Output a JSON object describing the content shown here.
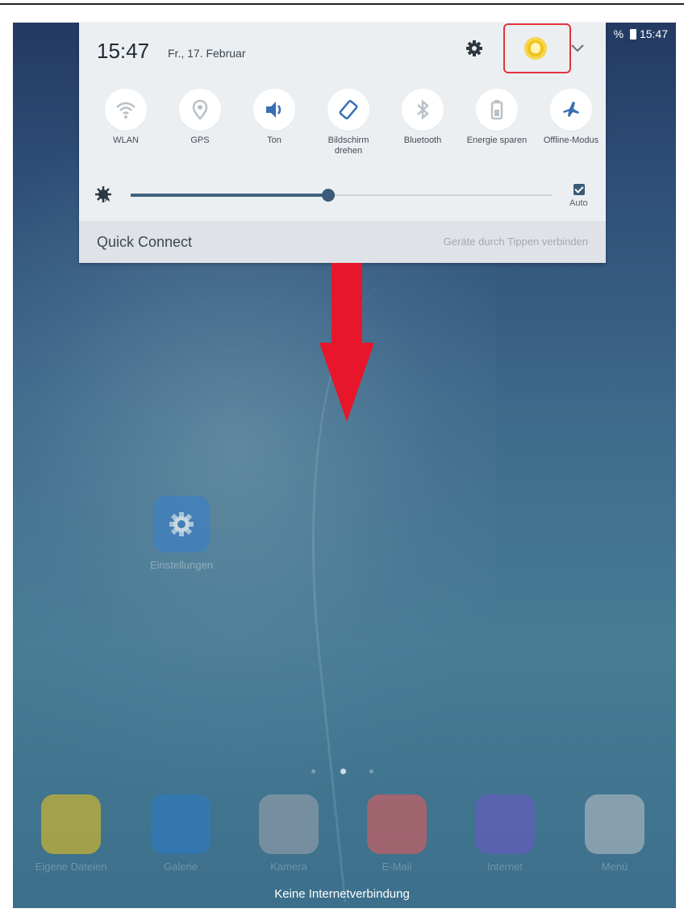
{
  "status_bar": {
    "battery_text": "% ",
    "time": "15:47"
  },
  "panel": {
    "time": "15:47",
    "date": "Fr., 17. Februar",
    "tiles": [
      {
        "label": "WLAN",
        "icon": "wifi-icon"
      },
      {
        "label": "GPS",
        "icon": "location-icon"
      },
      {
        "label": "Ton",
        "icon": "sound-icon"
      },
      {
        "label": "Bildschirm drehen",
        "icon": "rotate-icon"
      },
      {
        "label": "Bluetooth",
        "icon": "bluetooth-icon"
      },
      {
        "label": "Energie sparen",
        "icon": "battery-saver-icon"
      },
      {
        "label": "Offline-Modus",
        "icon": "airplane-icon"
      }
    ],
    "brightness": {
      "level": 0.47,
      "auto_label": "Auto",
      "auto_checked": true
    },
    "quick_connect": {
      "title": "Quick Connect",
      "hint": "Geräte durch Tippen verbinden"
    }
  },
  "home": {
    "settings_app_label": "Einstellungen",
    "page_indicator": {
      "count": 3,
      "active": 1
    },
    "dock": [
      {
        "label": "Eigene Dateien",
        "color": "#e6c020"
      },
      {
        "label": "Galerie",
        "color": "#2f7ac4"
      },
      {
        "label": "Kamera",
        "color": "#9aa2ad"
      },
      {
        "label": "E-Mail",
        "color": "#e25b5b"
      },
      {
        "label": "Internet",
        "color": "#6b58c4"
      },
      {
        "label": "Menü",
        "color": "#b8bec6"
      }
    ],
    "no_connection": "Keine Internetverbindung"
  },
  "colors": {
    "accent": "#3a5c78",
    "arrow": "#e8162a",
    "highlight": "#e0343c"
  }
}
